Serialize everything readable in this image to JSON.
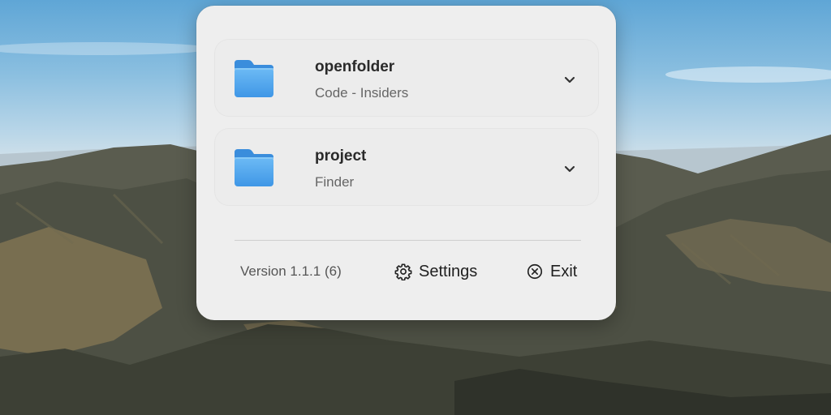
{
  "items": [
    {
      "title": "openfolder",
      "subtitle": "Code - Insiders",
      "icon": "folder-icon",
      "expand_icon": "chevron-down-icon"
    },
    {
      "title": "project",
      "subtitle": "Finder",
      "icon": "folder-icon",
      "expand_icon": "chevron-down-icon"
    }
  ],
  "footer": {
    "version": "Version 1.1.1 (6)",
    "settings_label": "Settings",
    "settings_icon": "gear-icon",
    "exit_label": "Exit",
    "exit_icon": "close-circle-icon"
  },
  "colors": {
    "folder_blue": "#5aaaf0",
    "panel_bg": "#eeeeee"
  }
}
